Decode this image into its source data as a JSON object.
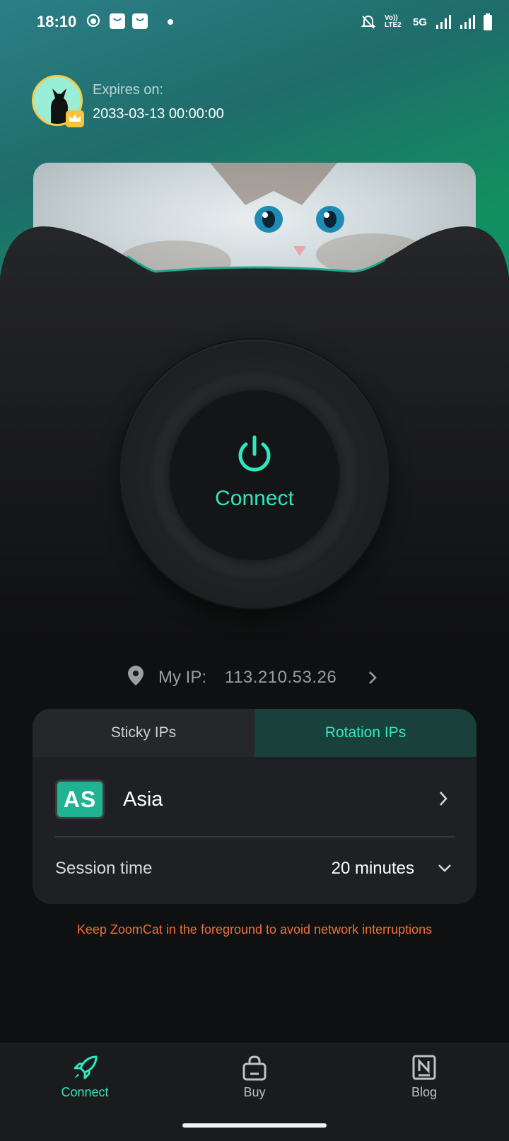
{
  "status_bar": {
    "time": "18:10",
    "network_label": "5G",
    "volte_label": "Vo)) LTE2",
    "icons": [
      "cat-app-icon",
      "shopping-bag-icon",
      "shopping-bag-icon",
      "dot-icon",
      "bell-off-icon",
      "signal-icon",
      "signal-icon",
      "battery-icon"
    ]
  },
  "profile": {
    "expires_label": "Expires on:",
    "expires_date": "2033-03-13 00:00:00"
  },
  "power": {
    "label": "Connect",
    "accent_color": "#2ee8c0"
  },
  "my_ip": {
    "label": "My IP:",
    "value": "113.210.53.26"
  },
  "tabs": [
    {
      "label": "Sticky IPs",
      "active": false
    },
    {
      "label": "Rotation IPs",
      "active": true
    }
  ],
  "region": {
    "badge": "AS",
    "name": "Asia"
  },
  "session": {
    "label": "Session time",
    "value": "20 minutes"
  },
  "warning": "Keep ZoomCat in the foreground to avoid network interruptions",
  "bottom_nav": [
    {
      "label": "Connect",
      "icon": "rocket-icon",
      "active": true
    },
    {
      "label": "Buy",
      "icon": "shopping-bag-icon",
      "active": false
    },
    {
      "label": "Blog",
      "icon": "notion-blog-icon",
      "active": false
    }
  ]
}
